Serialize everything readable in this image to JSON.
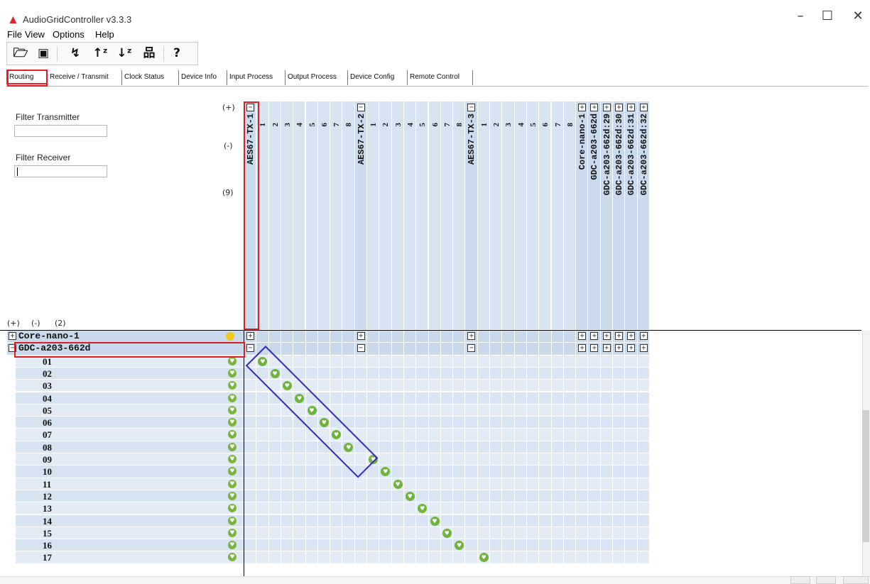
{
  "window": {
    "title": "AudioGridController v3.3.3",
    "minimize": "–",
    "maximize": "☐",
    "close": "✕"
  },
  "menu": [
    "File",
    "View",
    "Options",
    "Help"
  ],
  "toolbar": {
    "icons": [
      "open-folder-icon",
      "save-icon",
      "refresh-icon",
      "sort-ascending-icon",
      "sort-descending-icon",
      "network-icon",
      "help-icon"
    ],
    "glyphs": [
      "🗁",
      "▣",
      "↯",
      "↑ᶻ",
      "↓ᶻ",
      "品",
      "?"
    ]
  },
  "tabs": [
    "Routing",
    "Receive / Transmit",
    "Clock Status",
    "Device Info",
    "Input Process",
    "Output Process",
    "Device Config",
    "Remote Control"
  ],
  "filters": {
    "transmitter_label": "Filter Transmitter",
    "receiver_label": "Filter Receiver"
  },
  "header_controls": {
    "plus": "(+)",
    "minus": "(-)",
    "count": "(9)"
  },
  "row_controls": {
    "plus": "(+)",
    "minus": "(-)",
    "count": "(2)"
  },
  "transmitters": [
    {
      "name": "AES67-TX-1",
      "expanded_icon": "⊟",
      "channels": [
        "1",
        "2",
        "3",
        "4",
        "5",
        "6",
        "7",
        "8"
      ]
    },
    {
      "name": "AES67-TX-2",
      "expanded_icon": "⊟",
      "channels": [
        "1",
        "2",
        "3",
        "4",
        "5",
        "6",
        "7",
        "8"
      ]
    },
    {
      "name": "AES67-TX-3",
      "expanded_icon": "⊟",
      "channels": [
        "1",
        "2",
        "3",
        "4",
        "5",
        "6",
        "7",
        "8"
      ]
    },
    {
      "name": "Core-nano-1",
      "expanded_icon": "⊞",
      "channels": []
    },
    {
      "name": "GDC-a203-662d",
      "expanded_icon": "⊞",
      "channels": []
    },
    {
      "name": "GDC-a203-662d:29",
      "expanded_icon": "⊞",
      "channels": []
    },
    {
      "name": "GDC-a203-662d:30",
      "expanded_icon": "⊞",
      "channels": []
    },
    {
      "name": "GDC-a203-662d:31",
      "expanded_icon": "⊞",
      "channels": []
    },
    {
      "name": "GDC-a203-662d:32",
      "expanded_icon": "⊞",
      "channels": []
    }
  ],
  "receivers": [
    {
      "name": "Core-nano-1",
      "expanded_icon": "⊞"
    },
    {
      "name": "GDC-a203-662d",
      "expanded_icon": "⊟",
      "channels": [
        "01",
        "02",
        "03",
        "04",
        "05",
        "06",
        "07",
        "08",
        "09",
        "10",
        "11",
        "12",
        "13",
        "14",
        "15",
        "16",
        "17"
      ]
    }
  ],
  "status_icon_glyph": "♥",
  "routes": [
    {
      "rx": "01",
      "tx": "AES67-TX-1",
      "ch": "1"
    },
    {
      "rx": "02",
      "tx": "AES67-TX-1",
      "ch": "2"
    },
    {
      "rx": "03",
      "tx": "AES67-TX-1",
      "ch": "3"
    },
    {
      "rx": "04",
      "tx": "AES67-TX-1",
      "ch": "4"
    },
    {
      "rx": "05",
      "tx": "AES67-TX-1",
      "ch": "5"
    },
    {
      "rx": "06",
      "tx": "AES67-TX-1",
      "ch": "6"
    },
    {
      "rx": "07",
      "tx": "AES67-TX-1",
      "ch": "7"
    },
    {
      "rx": "08",
      "tx": "AES67-TX-1",
      "ch": "8"
    },
    {
      "rx": "09",
      "tx": "AES67-TX-2",
      "ch": "1"
    },
    {
      "rx": "10",
      "tx": "AES67-TX-2",
      "ch": "2"
    },
    {
      "rx": "11",
      "tx": "AES67-TX-2",
      "ch": "3"
    },
    {
      "rx": "12",
      "tx": "AES67-TX-2",
      "ch": "4"
    },
    {
      "rx": "13",
      "tx": "AES67-TX-2",
      "ch": "5"
    },
    {
      "rx": "14",
      "tx": "AES67-TX-2",
      "ch": "6"
    },
    {
      "rx": "15",
      "tx": "AES67-TX-2",
      "ch": "7"
    },
    {
      "rx": "16",
      "tx": "AES67-TX-2",
      "ch": "8"
    },
    {
      "rx": "17",
      "tx": "AES67-TX-3",
      "ch": "1"
    }
  ],
  "colors": {
    "highlight_red": "#d92027",
    "highlight_blue": "#3229c4",
    "route_green": "#6fb43a",
    "grid_blue": "#d6e3f1"
  }
}
